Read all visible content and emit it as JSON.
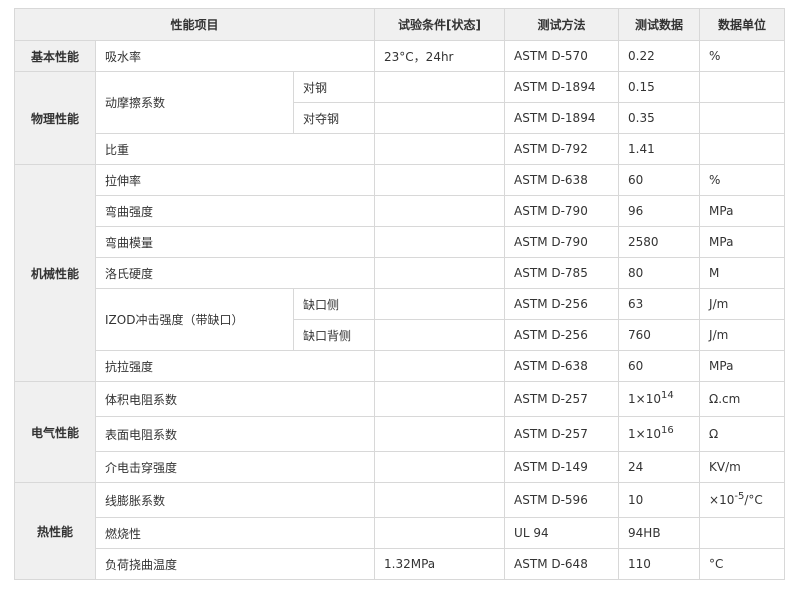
{
  "headers": {
    "item": "性能项目",
    "condition": "试验条件[状态]",
    "method": "测试方法",
    "value": "测试数据",
    "unit": "数据单位"
  },
  "categories": {
    "basic": "基本性能",
    "physical": "物理性能",
    "mechanical": "机械性能",
    "electrical": "电气性能",
    "thermal": "热性能"
  },
  "rows": {
    "water_absorption": {
      "item": "吸水率",
      "condition": "23°C，24hr",
      "method": "ASTM D-570",
      "value": "0.22",
      "unit": "%"
    },
    "friction": {
      "item": "动摩擦系数"
    },
    "friction_steel": {
      "sub": "对钢",
      "method": "ASTM D-1894",
      "value": "0.15"
    },
    "friction_self": {
      "sub": "对夺钢",
      "method": "ASTM D-1894",
      "value": "0.35"
    },
    "specific_gravity": {
      "item": "比重",
      "method": "ASTM D-792",
      "value": "1.41"
    },
    "elongation": {
      "item": "拉伸率",
      "method": "ASTM D-638",
      "value": "60",
      "unit": "%"
    },
    "flex_strength": {
      "item": "弯曲强度",
      "method": "ASTM D-790",
      "value": "96",
      "unit": "MPa"
    },
    "flex_modulus": {
      "item": "弯曲模量",
      "method": "ASTM D-790",
      "value": "2580",
      "unit": "MPa"
    },
    "rockwell": {
      "item": "洛氏硬度",
      "method": "ASTM D-785",
      "value": "80",
      "unit": "M"
    },
    "izod": {
      "item": "IZOD冲击强度（带缺口）"
    },
    "izod_notch": {
      "sub": "缺口侧",
      "method": "ASTM D-256",
      "value": "63",
      "unit": "J/m"
    },
    "izod_back": {
      "sub": "缺口背侧",
      "method": "ASTM D-256",
      "value": "760",
      "unit": "J/m"
    },
    "tensile": {
      "item": "抗拉强度",
      "method": "ASTM D-638",
      "value": "60",
      "unit": "MPa"
    },
    "volume_resistivity": {
      "item": "体积电阻系数",
      "method": "ASTM D-257",
      "value_base": "1×10",
      "value_exp": "14",
      "unit": "Ω.cm"
    },
    "surface_resistivity": {
      "item": "表面电阻系数",
      "method": "ASTM D-257",
      "value_base": "1×10",
      "value_exp": "16",
      "unit": "Ω"
    },
    "dielectric": {
      "item": "介电击穿强度",
      "method": "ASTM D-149",
      "value": "24",
      "unit": "KV/m"
    },
    "expansion": {
      "item": "线膨胀系数",
      "method": "ASTM D-596",
      "value": "10",
      "unit_base": "×10",
      "unit_exp": "-5",
      "unit_tail": "/°C"
    },
    "flammability": {
      "item": "燃烧性",
      "method": "UL 94",
      "value": "94HB"
    },
    "hdt": {
      "item": "负荷挠曲温度",
      "condition": "1.32MPa",
      "method": "ASTM D-648",
      "value": "110",
      "unit": "°C"
    }
  }
}
